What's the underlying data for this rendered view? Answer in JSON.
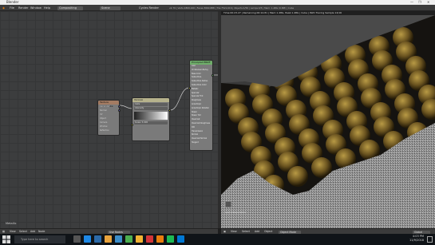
{
  "window": {
    "title": "Blender",
    "controls": [
      "—",
      "❐",
      "✕"
    ]
  },
  "topbar": {
    "menus": [
      "File",
      "Render",
      "Window",
      "Help"
    ],
    "layout": "Compositing",
    "scene": "Scene",
    "engine": "Cycles Render",
    "stats": "v2.79 | Verts:1869,100 | Faces:3660,888 | Tris:7521,616 | Objects:1/56 | Lamps:0/5 | Mem: 1.48G (0.8M) | Cube"
  },
  "node_editor": {
    "label": "Metallic",
    "footer_menus": [
      "View",
      "Select",
      "Add",
      "Node"
    ],
    "footer_fields": [
      "Use Nodes"
    ],
    "nodes": [
      {
        "name": "Texture Coordinate",
        "header_color": "#a37b62",
        "rows": [
          "Generated",
          "Normal",
          "UV",
          "Object",
          "Camera",
          "Window",
          "Reflection"
        ]
      },
      {
        "name": "Voronoi",
        "header_color": "#b6b28c",
        "rows": [
          "Cells",
          "Intensity",
          "Scale: 5.000"
        ]
      },
      {
        "name": "Principled BSDF",
        "header_color": "#6fae6a",
        "rows": [
          "GGX",
          "Christensen-Burley",
          "Base Color",
          "Subsurface",
          "Subsurface Radius",
          "Subsurface Color",
          "Metallic",
          "Specular",
          "Specular Tint",
          "Roughness",
          "Anisotropic",
          "Anisotropic Rotation",
          "Sheen",
          "Sheen Tint",
          "Clearcoat",
          "Clearcoat Roughness",
          "IOR",
          "Transmission",
          "Normal",
          "Clearcoat Normal",
          "Tangent"
        ]
      }
    ]
  },
  "viewport": {
    "header_text": "Time:00:23.27 | Remaining:00:14.81 | Mem:1.48G, Peak:1.48G | Cube | Path Tracing Sample 14/16",
    "overlay_label": "Last Interpolation",
    "footer_menus": [
      "View",
      "Select",
      "Add",
      "Object"
    ],
    "mode": "Object Mode",
    "shading": "Global"
  },
  "taskbar": {
    "search_placeholder": "Type here to search",
    "time": "4:03 PM",
    "date": "11/9/2018",
    "app_icon_colors": [
      "#555555",
      "#1e88e5",
      "#2c6aa8",
      "#e8a33d",
      "#3c8dc9",
      "#4caf50",
      "#f2b233",
      "#d13438",
      "#e87d0d",
      "#1db954",
      "#0078d4"
    ]
  }
}
